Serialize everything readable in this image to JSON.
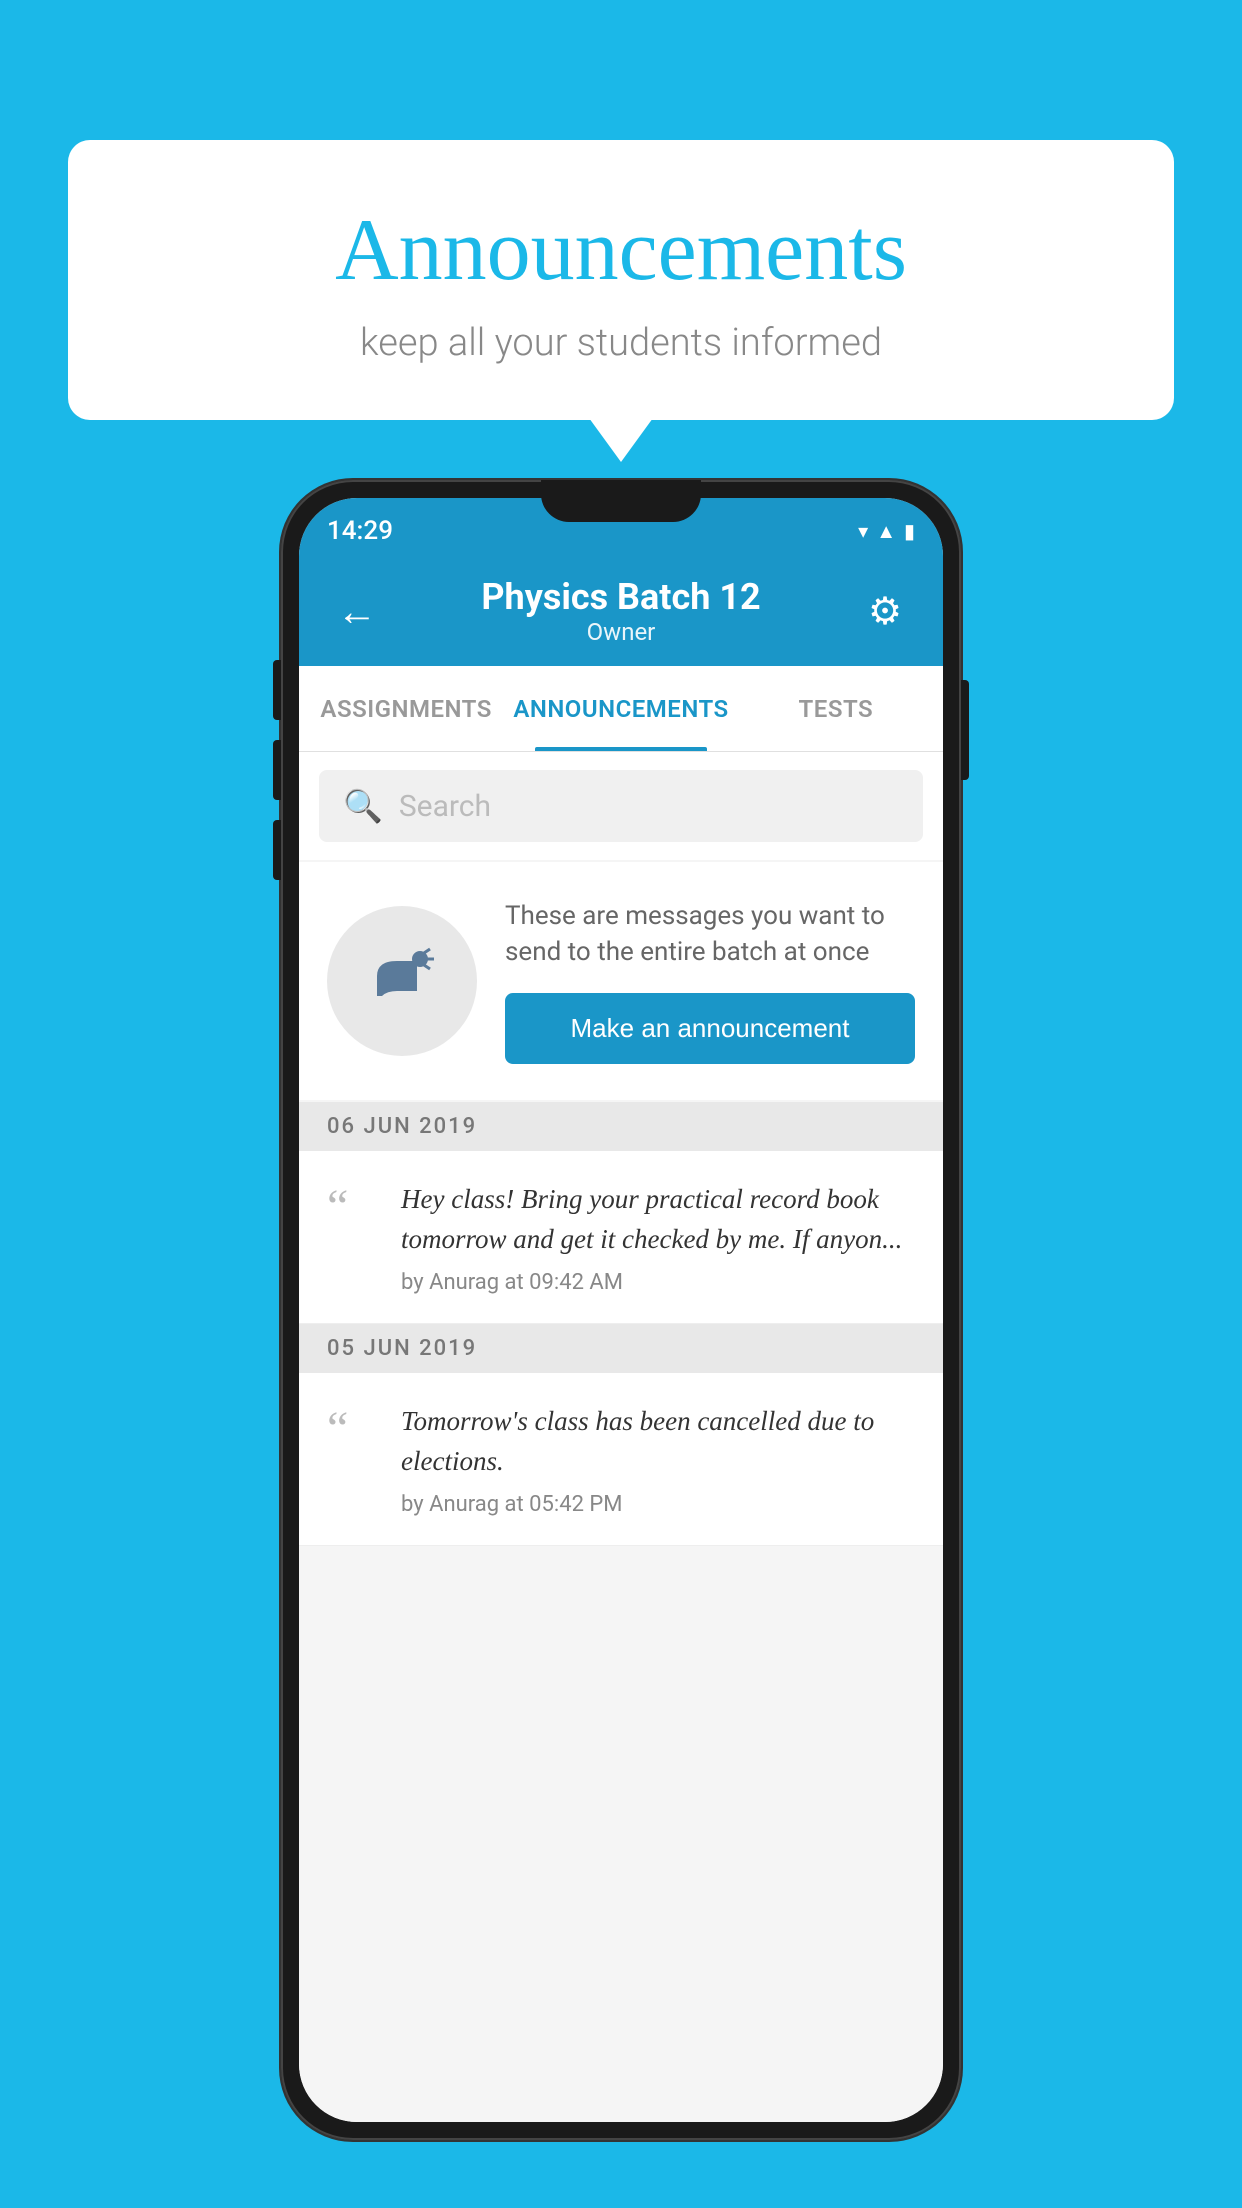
{
  "background_color": "#1bb8e8",
  "speech_bubble": {
    "title": "Announcements",
    "subtitle": "keep all your students informed"
  },
  "phone": {
    "status_bar": {
      "time": "14:29",
      "icons": [
        "wifi",
        "signal",
        "battery"
      ]
    },
    "app_bar": {
      "back_icon": "back-arrow",
      "title": "Physics Batch 12",
      "subtitle": "Owner",
      "settings_icon": "gear"
    },
    "tabs": [
      {
        "label": "ASSIGNMENTS",
        "active": false
      },
      {
        "label": "ANNOUNCEMENTS",
        "active": true
      },
      {
        "label": "TESTS",
        "active": false
      }
    ],
    "search": {
      "placeholder": "Search"
    },
    "promo": {
      "description": "These are messages you want to send to the entire batch at once",
      "button_label": "Make an announcement"
    },
    "announcements": [
      {
        "date": "06  JUN  2019",
        "text": "Hey class! Bring your practical record book tomorrow and get it checked by me. If anyon...",
        "meta": "by Anurag at 09:42 AM"
      },
      {
        "date": "05  JUN  2019",
        "text": "Tomorrow's class has been cancelled due to elections.",
        "meta": "by Anurag at 05:42 PM"
      }
    ]
  }
}
